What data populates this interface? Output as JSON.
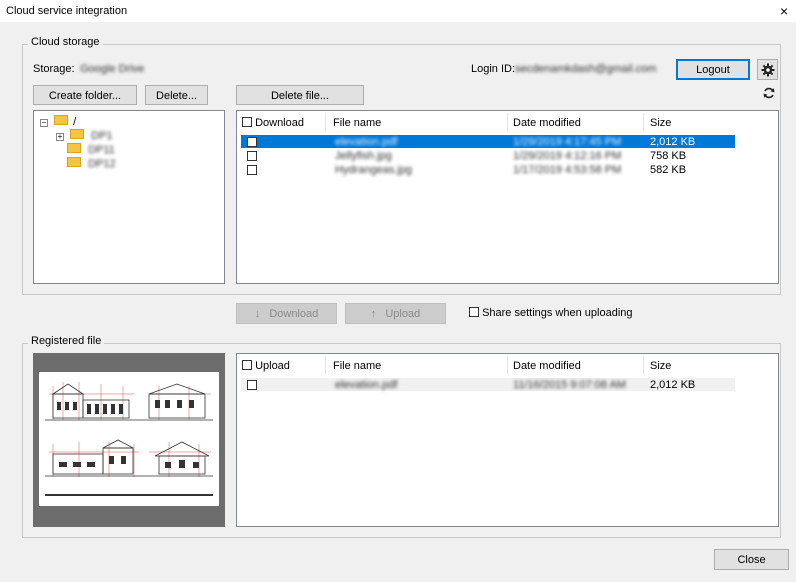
{
  "window": {
    "title": "Cloud service integration",
    "close_glyph": "×"
  },
  "cloud_storage": {
    "legend": "Cloud storage",
    "storage_label": "Storage:",
    "storage_value": "Google Drive",
    "login_label": "Login ID:",
    "login_value": "secdenamkdash@gmail.com",
    "logout_label": "Logout",
    "create_folder_label": "Create folder...",
    "delete_label": "Delete...",
    "delete_file_label": "Delete file...",
    "settings_icon": "gear-icon",
    "refresh_icon": "refresh-icon",
    "tree": {
      "root": "/",
      "folders": [
        "DP1",
        "DP11",
        "DP12"
      ]
    },
    "files": {
      "headers": {
        "download": "Download",
        "name": "File name",
        "date": "Date modified",
        "size": "Size"
      },
      "rows": [
        {
          "name": "elevation.pdf",
          "date": "1/29/2019 4:17:45 PM",
          "size": "2,012 KB",
          "selected": true
        },
        {
          "name": "Jellyfish.jpg",
          "date": "1/29/2019 4:12:16 PM",
          "size": "758 KB",
          "selected": false
        },
        {
          "name": "Hydrangeas.jpg",
          "date": "1/17/2019 4:53:58 PM",
          "size": "582 KB",
          "selected": false
        }
      ]
    }
  },
  "transfer": {
    "download_label": "Download",
    "upload_label": "Upload",
    "share_label": "Share settings when uploading"
  },
  "registered": {
    "legend": "Registered file",
    "headers": {
      "upload": "Upload",
      "name": "File name",
      "date": "Date modified",
      "size": "Size"
    },
    "rows": [
      {
        "name": "elevation.pdf",
        "date": "11/16/2015 9:07:08 AM",
        "size": "2,012 KB"
      }
    ]
  },
  "footer": {
    "close_label": "Close"
  },
  "colors": {
    "accent": "#0078d7",
    "dialog_bg": "#f0f0f0",
    "button_bg": "#e1e1e1"
  }
}
